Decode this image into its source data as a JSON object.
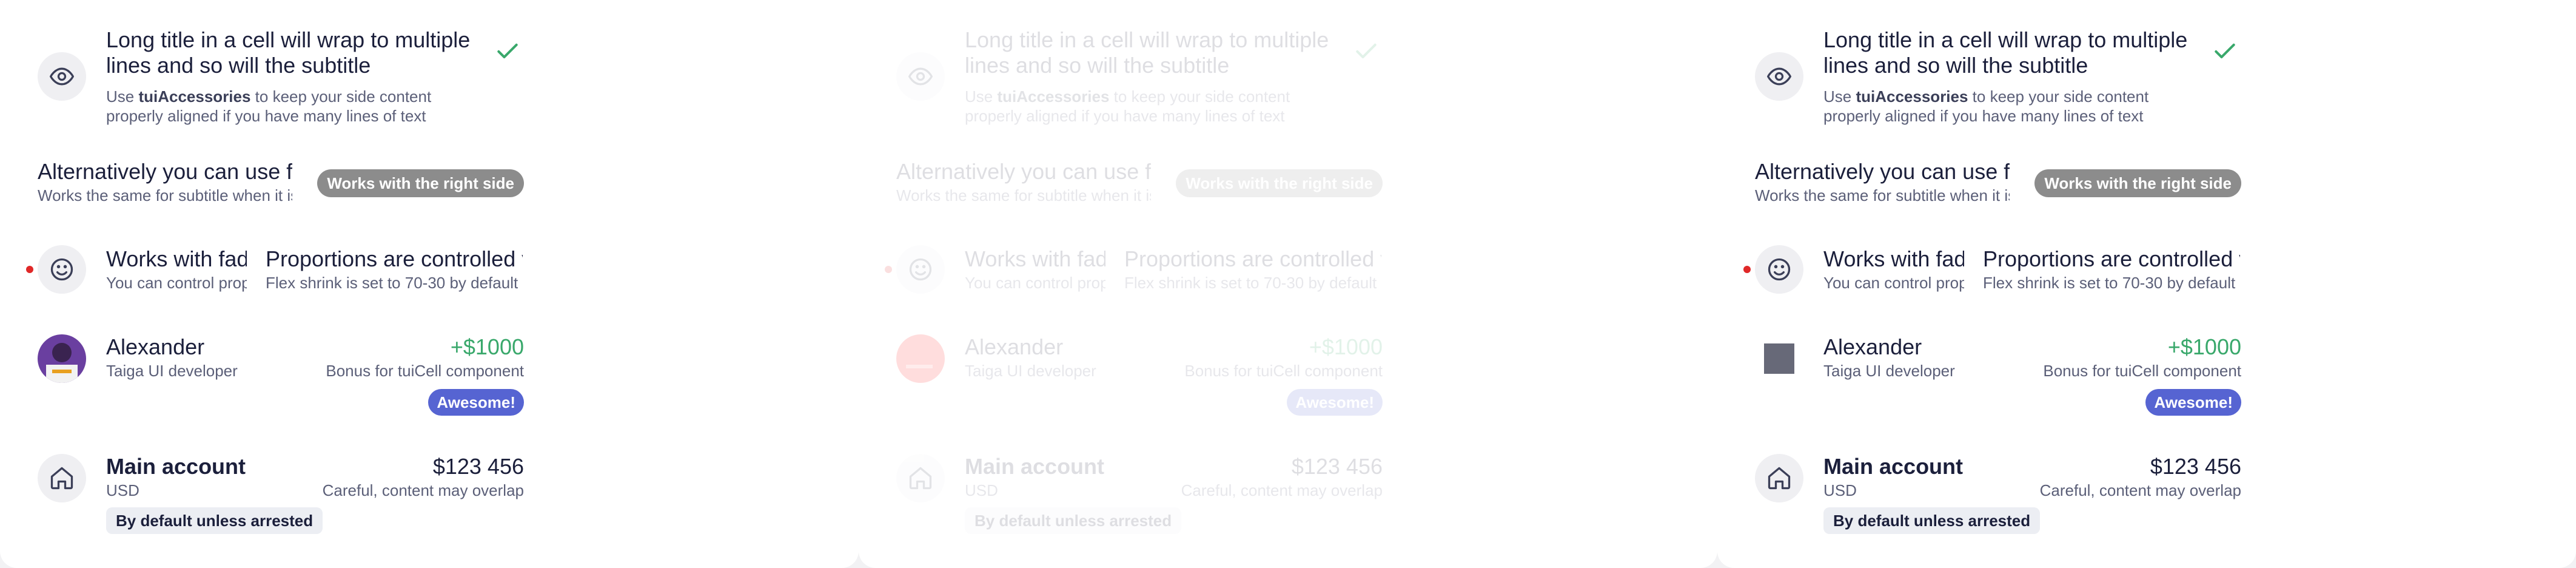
{
  "rows": {
    "long_title": {
      "title_line1": "Long title in a cell will wrap to multiple",
      "title_line2": "lines and so will the subtitle",
      "subtitle_prefix": "Use ",
      "subtitle_bold": "tuiAccessories",
      "subtitle_rest_line1": " to keep your side content",
      "subtitle_line2": "properly aligned if you have many lines of text",
      "icon": "eye-icon",
      "trailing_icon": "check-icon"
    },
    "alternative": {
      "title": "Alternatively you can use fade",
      "subtitle": "Works the same for subtitle when it is long",
      "badge": "Works with the right side"
    },
    "fade": {
      "title": "Works with fade",
      "subtitle": "You can control proportions",
      "right_title": "Proportions are controlled via CSS",
      "right_subtitle": "Flex shrink is set to 70-30 by default",
      "icon": "smile-icon"
    },
    "user": {
      "name": "Alexander",
      "role": "Taiga UI developer",
      "amount": "+$1000",
      "note": "Bonus for tuiCell component",
      "badge": "Awesome!"
    },
    "account": {
      "title": "Main account",
      "currency": "USD",
      "amount": "$123 456",
      "note": "Careful, content may overlap",
      "chip": "By default unless arrested",
      "icon": "home-icon"
    }
  },
  "colors": {
    "accent_green": "#39a86b",
    "badge_gray": "#8c8c8c",
    "badge_blue": "#5664d2",
    "dot_red": "#e02828"
  }
}
